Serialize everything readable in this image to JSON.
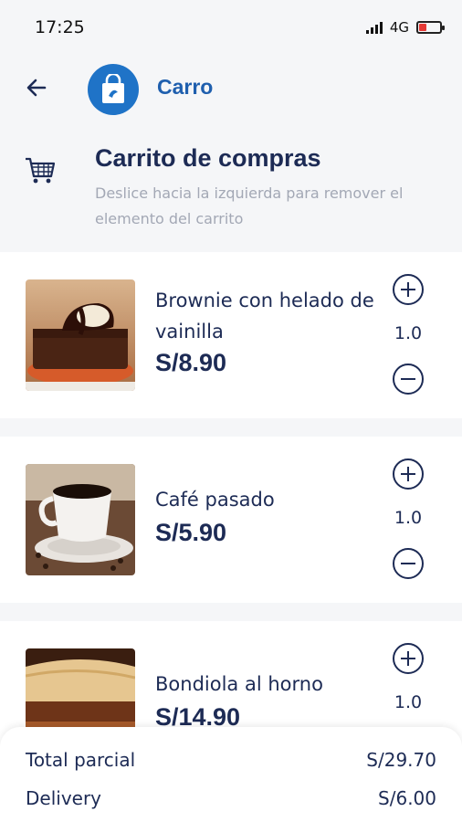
{
  "status_bar": {
    "time": "17:25",
    "network": "4G"
  },
  "app_bar": {
    "title": "Carro"
  },
  "cart_header": {
    "title": "Carrito de compras",
    "subtitle": "Deslice hacia la izquierda para remover el elemento del carrito"
  },
  "items": [
    {
      "name": "Brownie con  helado de vainilla",
      "price": "S/8.90",
      "quantity": "1.0"
    },
    {
      "name": "Café pasado",
      "price": "S/5.90",
      "quantity": "1.0"
    },
    {
      "name": "Bondiola al horno",
      "price": "S/14.90",
      "quantity": "1.0"
    }
  ],
  "summary": {
    "subtotal_label": "Total parcial",
    "subtotal_value": "S/29.70",
    "delivery_label": "Delivery",
    "delivery_value": "S/6.00"
  },
  "colors": {
    "accent": "#1f73c7",
    "title_blue": "#1f5fae",
    "text_navy": "#1d2b55",
    "subtitle_gray": "#a3a8b5",
    "battery_low": "#e53935"
  },
  "icons": [
    "back-arrow-icon",
    "shopping-bag-icon",
    "cart-icon",
    "plus-icon",
    "minus-icon",
    "signal-icon",
    "battery-icon"
  ]
}
